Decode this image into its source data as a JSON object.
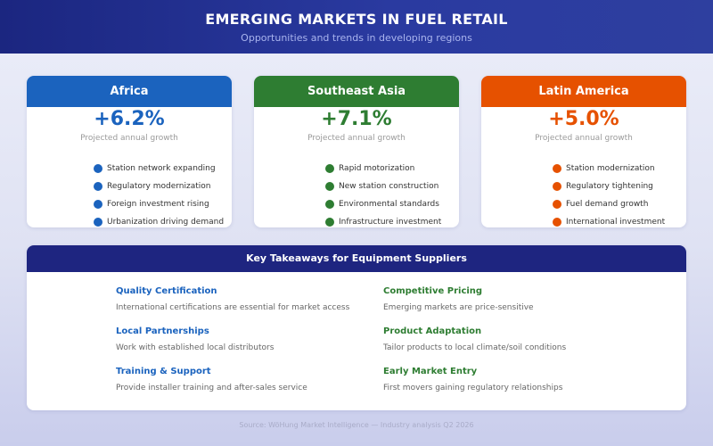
{
  "header": {
    "title": "EMERGING MARKETS IN FUEL RETAIL",
    "subtitle": "Opportunities and trends in developing regions"
  },
  "regions": [
    {
      "name": "Africa",
      "growth": "+6.2%",
      "growth_label": "Projected annual growth",
      "color": "#1b63be",
      "items": [
        "Station network expanding",
        "Regulatory modernization",
        "Foreign investment rising",
        "Urbanization driving demand"
      ]
    },
    {
      "name": "Southeast Asia",
      "growth": "+7.1%",
      "growth_label": "Projected annual growth",
      "color": "#2e7d32",
      "items": [
        "Rapid motorization",
        "New station construction",
        "Environmental standards",
        "Infrastructure investment"
      ]
    },
    {
      "name": "Latin America",
      "growth": "+5.0%",
      "growth_label": "Projected annual growth",
      "color": "#e65100",
      "items": [
        "Station modernization",
        "Regulatory tightening",
        "Fuel demand growth",
        "International investment"
      ]
    }
  ],
  "takeaways": {
    "title": "Key Takeaways for Equipment Suppliers",
    "header_color": "#1e2580",
    "blue": "#1b63be",
    "green": "#2e7d32",
    "items": [
      {
        "title": "Quality Certification",
        "desc": "International certifications are essential for market access"
      },
      {
        "title": "Competitive Pricing",
        "desc": "Emerging markets are price-sensitive"
      },
      {
        "title": "Local Partnerships",
        "desc": "Work with established local distributors"
      },
      {
        "title": "Product Adaptation",
        "desc": "Tailor products to local climate/soil conditions"
      },
      {
        "title": "Training & Support",
        "desc": "Provide installer training and after-sales service"
      },
      {
        "title": "Early Market Entry",
        "desc": "First movers gaining regulatory relationships"
      }
    ]
  },
  "footer": {
    "source": "Source: WöHung Market Intelligence — Industry analysis Q2 2026"
  }
}
